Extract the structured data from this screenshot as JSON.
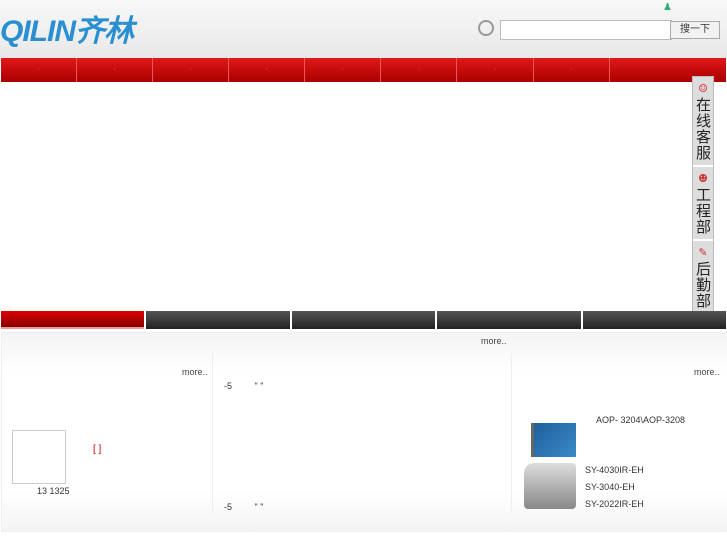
{
  "header": {
    "logo_latin": "QILIN",
    "logo_cn": "齐林",
    "search_placeholder": "",
    "search_button": "搜一下"
  },
  "nav": {
    "items": [
      "·",
      "·",
      "·",
      "·",
      "·",
      "·",
      "·",
      "·",
      ""
    ]
  },
  "side_service": [
    {
      "icon": "customer-service-icon",
      "label": "在线客服"
    },
    {
      "icon": "engineer-icon",
      "label": "工程部"
    },
    {
      "icon": "pencil-icon",
      "label": "后勤部"
    }
  ],
  "panel": {
    "top_more": "more..",
    "left": {
      "more": "more..",
      "bracket": "[ ]",
      "phone": "13 1325"
    },
    "middle": {
      "line1": "-5",
      "line1b": "\" \"",
      "line2": "-5",
      "line2b": "\" \""
    },
    "right": {
      "more": "more..",
      "products": [
        "AOP- 3204\\AOP-3208",
        "SY-4030IR-EH",
        "SY-3040-EH",
        "SY-2022IR-EH"
      ]
    }
  }
}
